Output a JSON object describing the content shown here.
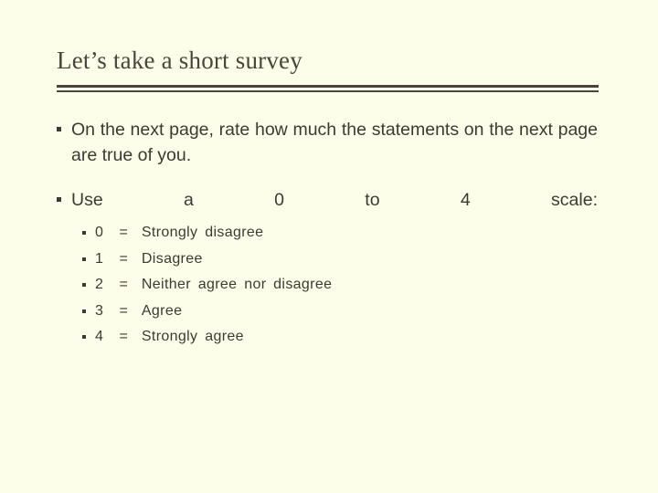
{
  "slide": {
    "background_color": "#fdfee9",
    "text_color": "#3d3a33",
    "title_color": "#4a453c",
    "rule_color": "#4a453c",
    "title": "Let’s take a short survey",
    "bullets": [
      {
        "bullet_glyph": "square",
        "text": "On the next page, rate how much the statements on the next page are true of you."
      },
      {
        "bullet_glyph": "square",
        "text": "Use a 0 to 4 scale:"
      }
    ],
    "scale_items": [
      {
        "bullet_glyph": "square",
        "key": "0",
        "equals": "=",
        "label": "Strongly disagree"
      },
      {
        "bullet_glyph": "square",
        "key": "1",
        "equals": "=",
        "label": "Disagree"
      },
      {
        "bullet_glyph": "square",
        "key": "2",
        "equals": "=",
        "label": "Neither agree nor disagree"
      },
      {
        "bullet_glyph": "square",
        "key": "3",
        "equals": "=",
        "label": "Agree"
      },
      {
        "bullet_glyph": "square",
        "key": "4",
        "equals": "=",
        "label": "Strongly agree"
      }
    ]
  }
}
